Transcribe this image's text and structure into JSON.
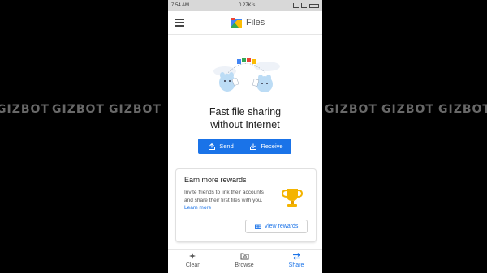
{
  "status_bar": {
    "time": "7:54 AM",
    "network_speed": "0.27K/s"
  },
  "app_bar": {
    "title": "Files",
    "menu_icon": "hamburger-menu-icon",
    "logo_icon": "files-logo-icon"
  },
  "hero": {
    "headline_line1": "Fast file sharing",
    "headline_line2": "without Internet",
    "illustration_icon": "file-sharing-illustration"
  },
  "actions": {
    "send_label": "Send",
    "receive_label": "Receive",
    "send_icon": "upload-icon",
    "receive_icon": "download-icon"
  },
  "rewards_card": {
    "title": "Earn more rewards",
    "body": "Invite friends to link their accounts and share their first files with you.",
    "link_label": "Learn more",
    "button_label": "View rewards",
    "trophy_icon": "trophy-icon"
  },
  "bottom_nav": {
    "items": [
      {
        "label": "Clean",
        "icon": "sparkle-icon",
        "active": false
      },
      {
        "label": "Browse",
        "icon": "folder-icon",
        "active": false
      },
      {
        "label": "Share",
        "icon": "swap-arrows-icon",
        "active": true
      }
    ]
  },
  "watermark": {
    "text": "GIZBOT"
  },
  "colors": {
    "accent": "#1a73e8",
    "background": "#000000",
    "trophy": "#f4b400"
  }
}
